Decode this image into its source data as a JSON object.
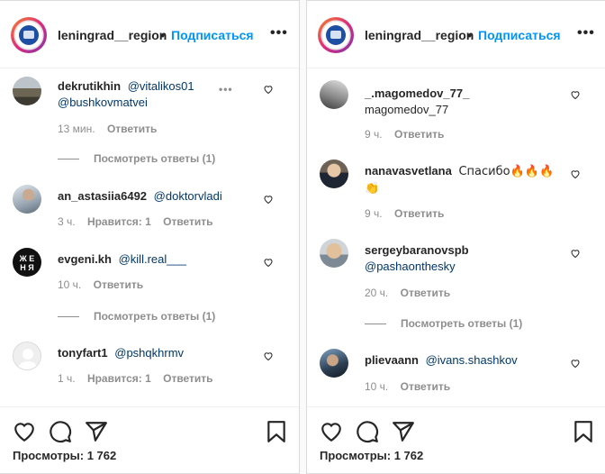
{
  "left": {
    "header": {
      "username": "leningrad__region",
      "separator": "•",
      "follow": "Подписаться",
      "more": "•••"
    },
    "comments": [
      {
        "user": "dekrutikhin",
        "mention1": "@vitalikos01",
        "mention2": "@bushkovmatvei",
        "time": "13 мин.",
        "reply": "Ответить",
        "more": "•••"
      },
      {
        "user": "an_astasiia6492",
        "mention1": "@doktorvladi",
        "time": "3 ч.",
        "likes": "Нравится: 1",
        "reply": "Ответить"
      },
      {
        "user": "evgeni.kh",
        "mention1": "@kill.real___",
        "time": "10 ч.",
        "reply": "Ответить",
        "avatar_text": "Ж Е\nН Я"
      },
      {
        "user": "tonyfart1",
        "mention1": "@pshqkhrmv",
        "time": "1 ч.",
        "likes": "Нравится: 1",
        "reply": "Ответить"
      }
    ],
    "view_replies_1": "Посмотреть ответы (1)",
    "view_replies_2": "Посмотреть ответы (1)",
    "views": "Просмотры: 1 762"
  },
  "right": {
    "header": {
      "username": "leningrad__region",
      "separator": "•",
      "follow": "Подписаться",
      "more": "•••"
    },
    "comments": [
      {
        "user": "_.magomedov_77_",
        "text": "magomedov_77",
        "time": "9 ч.",
        "reply": "Ответить"
      },
      {
        "user": "nanavasvetlana",
        "text": "Спасибо🔥🔥🔥",
        "text2": "👏",
        "time": "9 ч.",
        "reply": "Ответить"
      },
      {
        "user": "sergeybaranovspb",
        "mention1": "@pashaonthesky",
        "time": "20 ч.",
        "reply": "Ответить"
      },
      {
        "user": "plievaann",
        "mention1": "@ivans.shashkov",
        "time": "10 ч.",
        "reply": "Ответить"
      }
    ],
    "view_replies_1": "Посмотреть ответы (1)",
    "views": "Просмотры: 1 762"
  },
  "colors": {
    "link": "#0095f6",
    "mention": "#00376b",
    "muted": "#8e8e8e"
  }
}
